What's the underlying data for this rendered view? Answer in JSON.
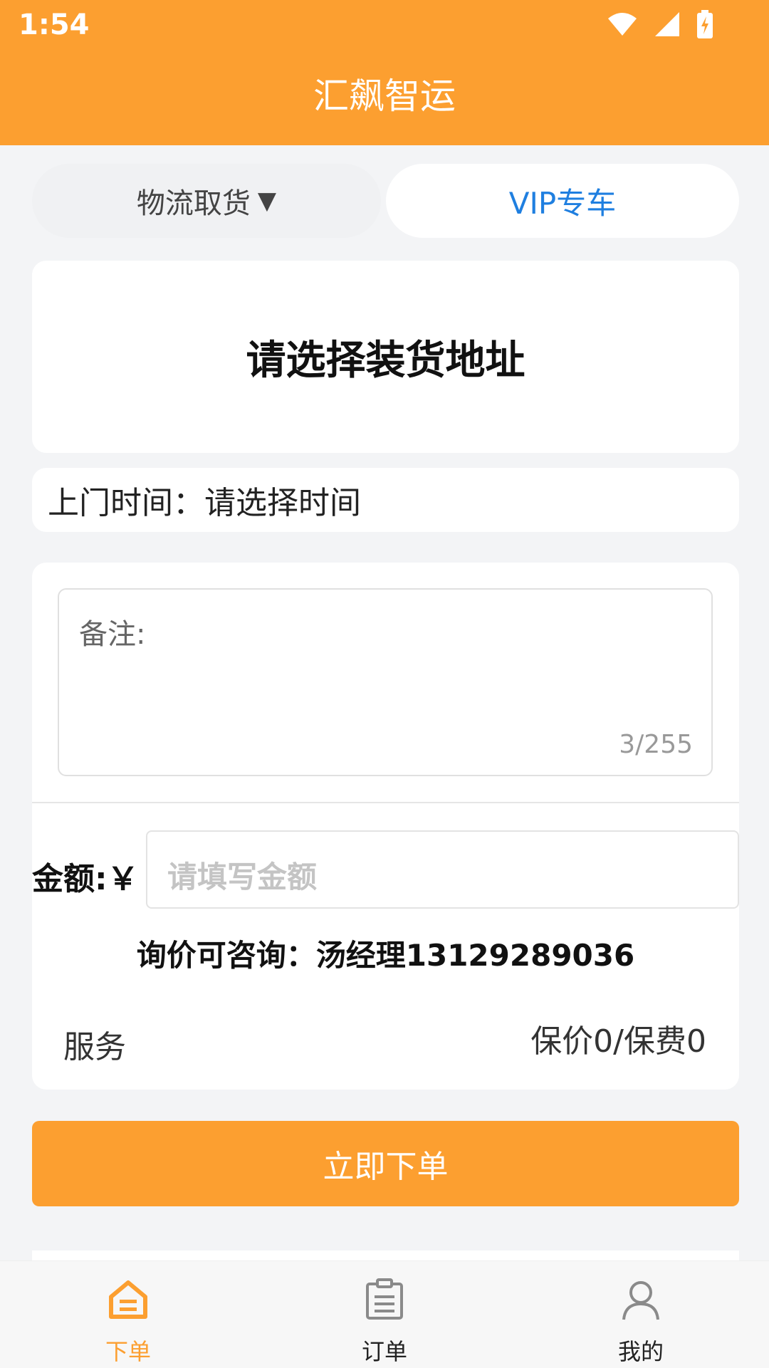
{
  "status_bar": {
    "time": "1:54"
  },
  "app_bar": {
    "title": "汇飙智运"
  },
  "tabs": [
    {
      "label": "物流取货",
      "dropdown_symbol": "▼",
      "selected": false
    },
    {
      "label": "VIP专车",
      "selected": true
    }
  ],
  "address_card": {
    "prompt": "请选择装货地址"
  },
  "time_card": {
    "text": "上门时间：请选择时间"
  },
  "remark": {
    "label": "备注:",
    "counter": "3/255"
  },
  "amount": {
    "label": "金额:￥",
    "placeholder": "请填写金额"
  },
  "inquiry": {
    "text": "询价可咨询：汤经理13129289036"
  },
  "service": {
    "label": "服务",
    "value": "保价0/保费0"
  },
  "submit": {
    "label": "立即下单"
  },
  "bottom_nav": [
    {
      "label": "下单",
      "icon": "home-icon",
      "active": true
    },
    {
      "label": "订单",
      "icon": "clipboard-icon",
      "active": false
    },
    {
      "label": "我的",
      "icon": "person-icon",
      "active": false
    }
  ],
  "colors": {
    "accent": "#fc9f30",
    "link": "#1f7fe0",
    "placeholder": "#c4c4c4"
  }
}
